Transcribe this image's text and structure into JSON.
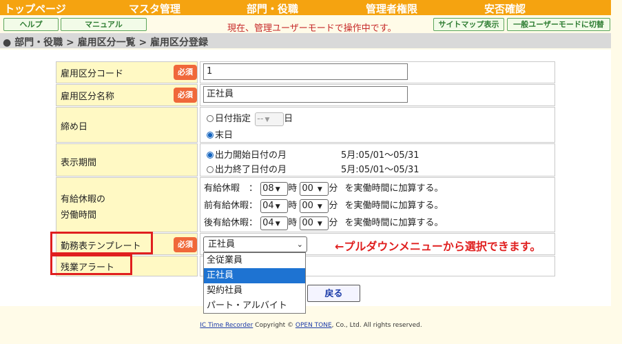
{
  "nav": {
    "items": [
      "トップページ",
      "マスタ管理",
      "部門・役職",
      "管理者権限",
      "安否確認"
    ]
  },
  "toolbar": {
    "help": "ヘルプ",
    "manual": "マニュアル",
    "mode_message": "現在、管理ユーザーモードで操作中です。",
    "sitemap": "サイトマップ表示",
    "switch_mode": "一般ユーザーモードに切替"
  },
  "breadcrumb": "● 部門・役職 > 雇用区分一覧 > 雇用区分登録",
  "form": {
    "required_badge": "必須",
    "code": {
      "label": "雇用区分コード",
      "value": "1"
    },
    "name": {
      "label": "雇用区分名称",
      "value": "正社員"
    },
    "closing": {
      "label": "締め日",
      "option_date": "日付指定",
      "day_select": "--",
      "day_suffix": "日",
      "option_month_end": "末日",
      "selected": "末日"
    },
    "display_period": {
      "label": "表示期間",
      "option_start": "出力開始日付の月",
      "option_end": "出力終了日付の月",
      "start_range": "5月:05/01～05/31",
      "end_range": "5月:05/01～05/31",
      "selected": "出力開始日付の月"
    },
    "paid_leave": {
      "label_line1": "有給休暇の",
      "label_line2": "労働時間",
      "rows": [
        {
          "label": "有給休暇　：",
          "hour": "08",
          "minute": "00"
        },
        {
          "label": "前有給休暇：",
          "hour": "04",
          "minute": "00"
        },
        {
          "label": "後有給休暇：",
          "hour": "04",
          "minute": "00"
        }
      ],
      "hour_unit": "時",
      "minute_unit": "分",
      "suffix": "を実働時間に加算する。"
    },
    "template": {
      "label": "勤務表テンプレート",
      "selected": "正社員",
      "options": [
        "全従業員",
        "正社員",
        "契約社員",
        "パート・アルバイト"
      ]
    },
    "overtime_alert": {
      "label": "残業アラート"
    }
  },
  "annotation": "←プルダウンメニューから選択できます。",
  "back_button": "戻る",
  "footer": {
    "product": "IC Time Recorder",
    "copyright_pre": " Copyright © ",
    "company": "OPEN TONE",
    "copyright_post": ", Co., Ltd. All rights reserved."
  },
  "colors": {
    "nav_bg": "#f5a310",
    "label_bg": "#fff9c4",
    "required_badge": "#f0683a",
    "highlight_red": "#e01f1f",
    "dropdown_selected": "#1e73d2"
  }
}
